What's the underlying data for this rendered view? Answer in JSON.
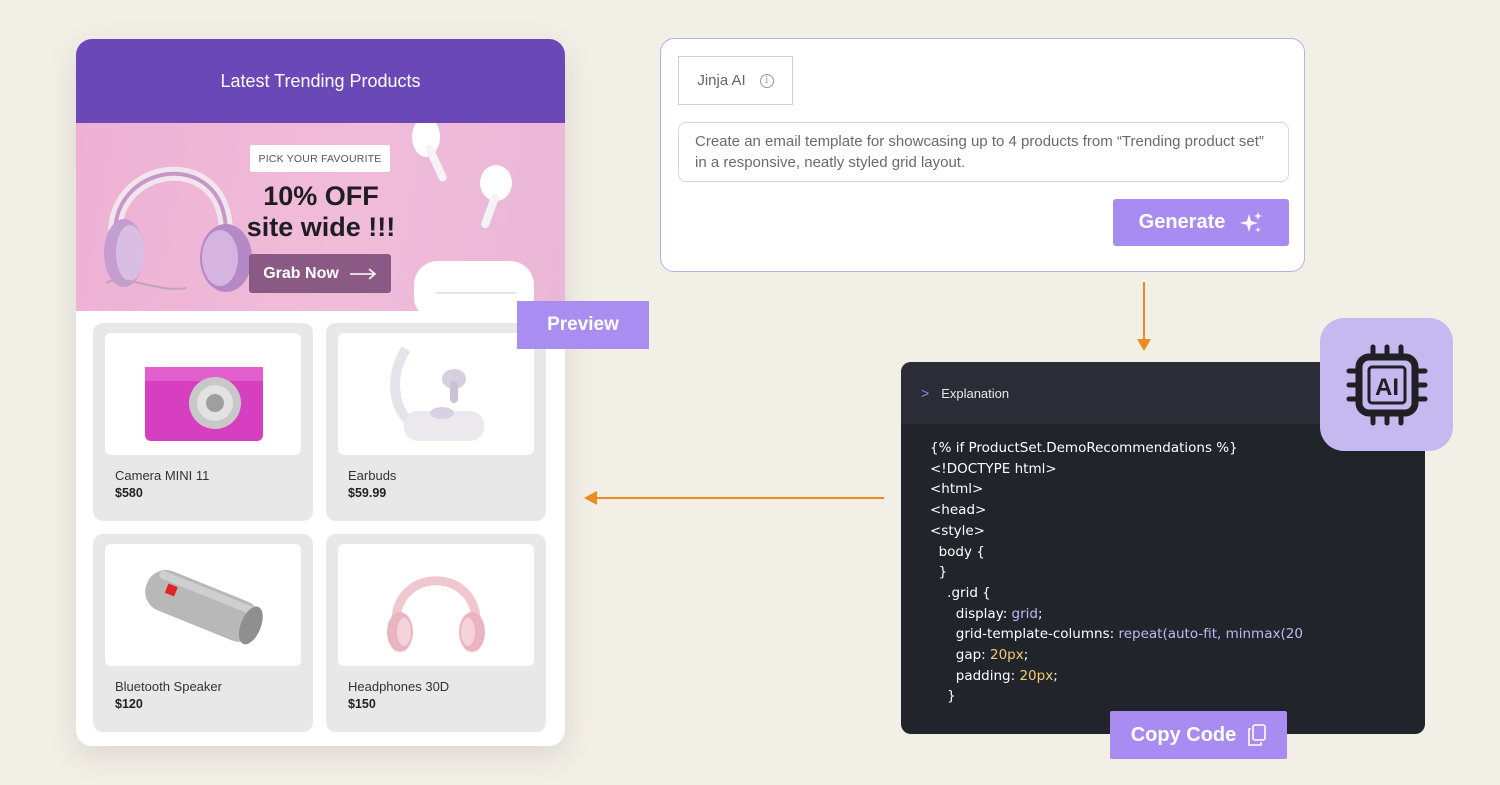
{
  "email": {
    "header_title": "Latest Trending Products",
    "banner": {
      "pill": "PICK YOUR FAVOURITE",
      "headline_line1": "10% OFF",
      "headline_line2": "site wide !!!",
      "cta": "Grab Now"
    },
    "products": [
      {
        "name": "Camera MINI 11",
        "price": "$580",
        "icon": "pink-camera-image"
      },
      {
        "name": "Earbuds",
        "price": "$59.99",
        "icon": "earbuds-case-image"
      },
      {
        "name": "Bluetooth Speaker",
        "price": "$120",
        "icon": "speaker-image"
      },
      {
        "name": "Headphones 30D",
        "price": "$150",
        "icon": "headphones-image"
      }
    ]
  },
  "preview_label": "Preview",
  "prompt": {
    "model": "Jinja AI",
    "text": "Create an email template for showcasing up to 4 products from “Trending product set” in a responsive, neatly styled grid layout.",
    "generate_label": "Generate"
  },
  "code": {
    "explanation_label": "Explanation",
    "lines": [
      "{% if ProductSet.DemoRecommendations %}",
      "<!DOCTYPE html>",
      "<html>",
      "<head>",
      "<style>",
      "  body {",
      "  }",
      "    .grid {",
      "      display: grid;",
      "      grid-template-columns: repeat(auto-fit, minmax(20",
      "      gap: 20px;",
      "      padding: 20px;",
      "    }"
    ],
    "copy_label": "Copy Code"
  },
  "ai_badge_icon": "ai-chip-icon",
  "colors": {
    "background": "#f2efe7",
    "header_purple": "#6a48b8",
    "accent_lavender": "#a88cf1",
    "arrow_orange": "#ef8a22",
    "code_bg": "#22242c"
  }
}
